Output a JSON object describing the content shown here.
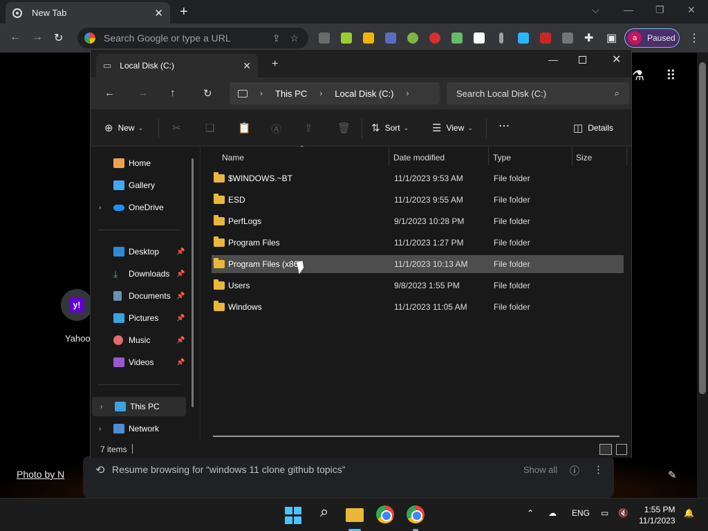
{
  "chrome": {
    "tab_title": "New Tab",
    "omnibox_placeholder": "Search Google or type a URL",
    "profile_initial": "a",
    "profile_status": "Paused"
  },
  "ntp": {
    "shortcut_label": "Yahoo",
    "shortcut_glyph": "y!",
    "photo_credit": "Photo by N",
    "resume_text": "Resume browsing for “windows 11 clone github topics”",
    "show_all": "Show all"
  },
  "explorer": {
    "tab_title": "Local Disk (C:)",
    "breadcrumb": [
      "This PC",
      "Local Disk (C:)"
    ],
    "search_placeholder": "Search Local Disk (C:)",
    "toolbar": {
      "new": "New",
      "sort": "Sort",
      "view": "View",
      "details": "Details"
    },
    "sidebar": {
      "home": "Home",
      "gallery": "Gallery",
      "onedrive": "OneDrive",
      "desktop": "Desktop",
      "downloads": "Downloads",
      "documents": "Documents",
      "pictures": "Pictures",
      "music": "Music",
      "videos": "Videos",
      "this_pc": "This PC",
      "network": "Network"
    },
    "columns": {
      "name": "Name",
      "date": "Date modified",
      "type": "Type",
      "size": "Size"
    },
    "files": [
      {
        "name": "$WINDOWS.~BT",
        "date": "11/1/2023 9:53 AM",
        "type": "File folder"
      },
      {
        "name": "ESD",
        "date": "11/1/2023 9:55 AM",
        "type": "File folder"
      },
      {
        "name": "PerfLogs",
        "date": "9/1/2023 10:28 PM",
        "type": "File folder"
      },
      {
        "name": "Program Files",
        "date": "11/1/2023 1:27 PM",
        "type": "File folder"
      },
      {
        "name": "Program Files (x86)",
        "date": "11/1/2023 10:13 AM",
        "type": "File folder"
      },
      {
        "name": "Users",
        "date": "9/8/2023 1:55 PM",
        "type": "File folder"
      },
      {
        "name": "Windows",
        "date": "11/1/2023 11:05 AM",
        "type": "File folder"
      }
    ],
    "status_count": "7 items"
  },
  "taskbar": {
    "language": "ENG",
    "time": "1:55 PM",
    "date": "11/1/2023"
  },
  "colors": {
    "accent": "#4cc2ff",
    "folder": "#e9b83b",
    "profile": "#c2185b"
  }
}
